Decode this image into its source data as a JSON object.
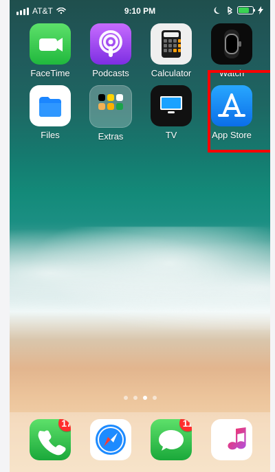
{
  "status_bar": {
    "carrier": "AT&T",
    "time": "9:10 PM"
  },
  "home": {
    "row1": [
      {
        "name": "FaceTime",
        "icon": "facetime-icon"
      },
      {
        "name": "Podcasts",
        "icon": "podcasts-icon"
      },
      {
        "name": "Calculator",
        "icon": "calculator-icon"
      },
      {
        "name": "Watch",
        "icon": "watch-icon"
      }
    ],
    "row2": [
      {
        "name": "Files",
        "icon": "files-icon"
      },
      {
        "name": "Extras",
        "icon": "extras-folder-icon"
      },
      {
        "name": "TV",
        "icon": "tv-icon"
      },
      {
        "name": "App Store",
        "icon": "app-store-icon"
      }
    ]
  },
  "page_indicator": {
    "count": 4,
    "active_index": 2
  },
  "dock": {
    "apps": [
      {
        "name": "Phone",
        "icon": "phone-icon",
        "badge": "17"
      },
      {
        "name": "Safari",
        "icon": "safari-icon",
        "badge": ""
      },
      {
        "name": "Messages",
        "icon": "messages-icon",
        "badge": "11"
      },
      {
        "name": "Music",
        "icon": "music-icon",
        "badge": ""
      }
    ]
  },
  "colors": {
    "highlight": "#ff0000",
    "badge": "#ff2d2d"
  }
}
